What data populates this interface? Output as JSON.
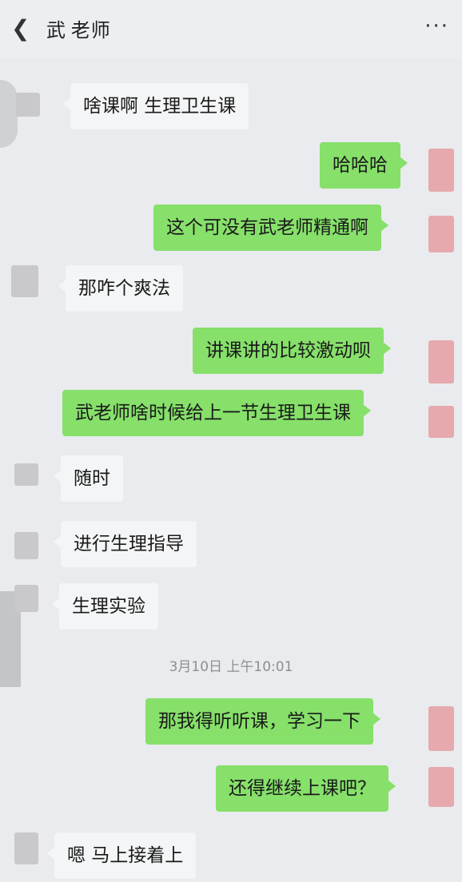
{
  "header": {
    "back_icon": "chevron-left-icon",
    "title": "武 老师",
    "more_icon": "more-horizontal-icon",
    "more_label": "···"
  },
  "messages": [
    {
      "side": "left",
      "text": "啥课啊 生理卫生课"
    },
    {
      "side": "right",
      "text": "哈哈哈"
    },
    {
      "side": "right",
      "text": "这个可没有武老师精通啊"
    },
    {
      "side": "left",
      "text": "那咋个爽法"
    },
    {
      "side": "right",
      "text": "讲课讲的比较激动呗"
    },
    {
      "side": "right",
      "text": "武老师啥时候给上一节生理卫生课"
    },
    {
      "side": "left",
      "text": "随时"
    },
    {
      "side": "left",
      "text": "进行生理指导"
    },
    {
      "side": "left",
      "text": "生理实验"
    },
    {
      "side": "right",
      "text": "那我得听听课，学习一下"
    },
    {
      "side": "right",
      "text": "还得继续上课吧？"
    },
    {
      "side": "left",
      "text": "嗯 马上接着上"
    }
  ],
  "timestamp": "3月10日 上午10:01",
  "colors": {
    "sent_bubble": "#86e06a",
    "received_bubble": "#f4f5f6",
    "background": "#e9ebee"
  }
}
